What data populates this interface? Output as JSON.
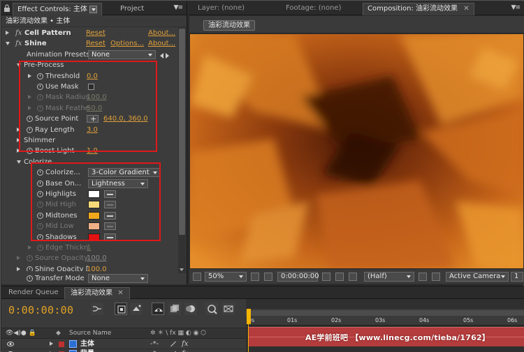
{
  "left_panel": {
    "tab_active": "Effect Controls: 主体",
    "tab_project": "Project",
    "subtitle": "油彩流动效果 • 主体",
    "effects": [
      {
        "label": "Cell Pattern",
        "reset": "Reset",
        "about": "About..."
      },
      {
        "label": "Shine",
        "reset": "Reset",
        "options": "Options...",
        "about": "About..."
      }
    ],
    "animation_presets": {
      "label": "Animation Presets:",
      "value": "None"
    },
    "pre_process": {
      "label": "Pre-Process",
      "threshold": {
        "label": "Threshold",
        "value": "0.0"
      },
      "use_mask": {
        "label": "Use Mask"
      },
      "mask_radius": {
        "label": "Mask Radius",
        "value": "100.0"
      },
      "mask_feather": {
        "label": "Mask Feathe",
        "value": "50.0"
      }
    },
    "source_point": {
      "label": "Source Point",
      "value": "640.0, 360.0"
    },
    "ray_length": {
      "label": "Ray Length",
      "value": "3.0"
    },
    "shimmer": {
      "label": "Shimmer"
    },
    "boost_light": {
      "label": "Boost Light",
      "value": "1.0"
    },
    "colorize": {
      "label": "Colorize",
      "colorize_dd": {
        "label": "Colorize...",
        "value": "3-Color Gradient"
      },
      "base_on": {
        "label": "Base On...",
        "value": "Lightness"
      },
      "highlights": {
        "label": "Highligts",
        "color": "#ffffff"
      },
      "mid_high": {
        "label": "Mid High",
        "color": "#f8d97a"
      },
      "midtones": {
        "label": "Midtones",
        "color": "#f2a81c"
      },
      "mid_low": {
        "label": "Mid Low",
        "color": "#f0b086"
      },
      "shadows": {
        "label": "Shadows",
        "color": "#e21212"
      }
    },
    "edge_thickness": {
      "label": "Edge Thickn",
      "value": "1"
    },
    "source_opacity": {
      "label": "Source Opacity",
      "value": "100.0"
    },
    "shine_opacity": {
      "label": "Shine Opacity [",
      "value": "100.0"
    },
    "transfer_mode": {
      "label": "Transfer Mode",
      "value": "None"
    }
  },
  "viewer": {
    "tab_layer": "Layer: (none)",
    "tab_footage": "Footage: (none)",
    "tab_composition": "Composition: 油彩流动效果",
    "comp_chip": "油彩流动效果",
    "zoom": "50%",
    "timecode": "0:00:00:00",
    "resolution": "(Half)",
    "camera": "Active Camera",
    "views": "1"
  },
  "timeline": {
    "tab_render_queue": "Render Queue",
    "tab_comp": "油彩流动效果",
    "timecode": "0:00:00:00",
    "source_name_header": "Source Name",
    "ruler_labels": [
      "0s",
      "01s",
      "02s",
      "03s",
      "04s",
      "05s",
      "06s"
    ],
    "layers": [
      {
        "name": "主体",
        "label_color": "#c03030"
      },
      {
        "name": "背景",
        "label_color": "#c03030"
      }
    ],
    "watermark": "AE学前班吧 【www.linecg.com/tieba/1762】"
  },
  "accent_colors": {
    "timecode": "#e2a224",
    "highlight_box": "#e0181a",
    "track": "#b43c3c"
  }
}
